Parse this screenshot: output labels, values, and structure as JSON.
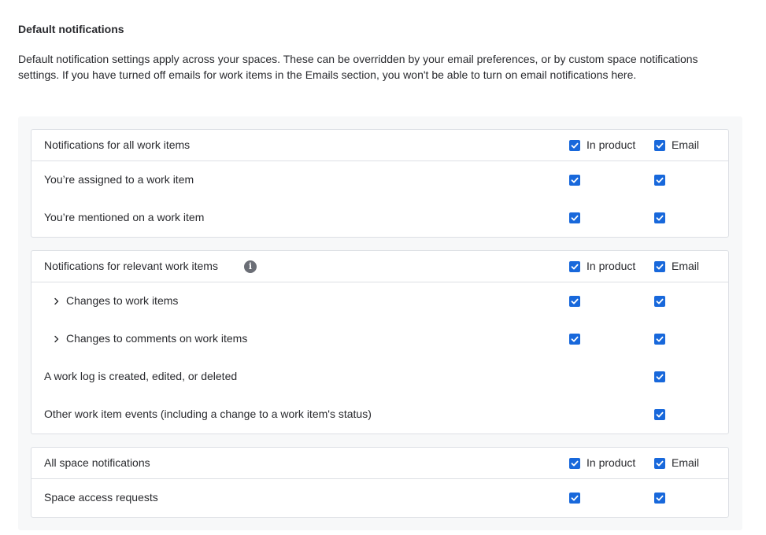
{
  "section": {
    "title": "Default notifications",
    "description": "Default notification settings apply across your spaces. These can be overridden by your email preferences, or by custom space notifications settings. If you have turned off emails for work items in the Emails section, you won't be able to turn on email notifications here."
  },
  "columns": {
    "in_product": "In product",
    "email": "Email"
  },
  "groups": [
    {
      "header": "Notifications for all work items",
      "header_in_product_checked": true,
      "header_email_checked": true,
      "rows": [
        {
          "label": "You’re assigned to a work item",
          "in_product": true,
          "email": true
        },
        {
          "label": "You’re mentioned on a work item",
          "in_product": true,
          "email": true
        }
      ]
    },
    {
      "header": "Notifications for relevant work items",
      "header_in_product_checked": true,
      "header_email_checked": true,
      "info_icon": "info-icon",
      "rows": [
        {
          "label": "Changes to work items",
          "in_product": true,
          "email": true,
          "expandable": true
        },
        {
          "label": "Changes to comments on work items",
          "in_product": true,
          "email": true,
          "expandable": true
        },
        {
          "label": "A work log is created, edited, or deleted",
          "in_product": null,
          "email": true
        },
        {
          "label": "Other work item events (including a change to a work item's status)",
          "in_product": null,
          "email": true
        }
      ]
    },
    {
      "header": "All space notifications",
      "header_in_product_checked": true,
      "header_email_checked": true,
      "rows": [
        {
          "label": "Space access requests",
          "in_product": true,
          "email": true
        }
      ]
    }
  ],
  "colors": {
    "checkbox": "#1868db",
    "border": "#dcdfe4",
    "panel_bg": "#f7f8f9",
    "text": "#292a2e"
  }
}
